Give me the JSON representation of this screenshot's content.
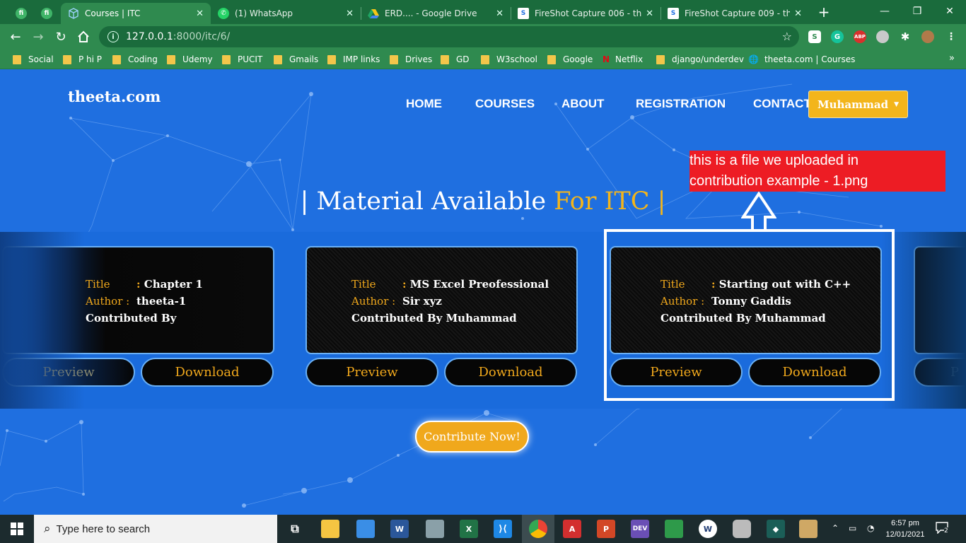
{
  "browser": {
    "tabs": [
      {
        "title": "Courses | ITC",
        "active": true
      },
      {
        "title": "(1) WhatsApp"
      },
      {
        "title": "ERD.... - Google Drive"
      },
      {
        "title": "FireShot Capture 006 - theeta"
      },
      {
        "title": "FireShot Capture 009 - theeta"
      }
    ],
    "pinned_tabs": [
      "fi",
      "fi"
    ],
    "url_host": "127.0.0.1",
    "url_path": ":8000/itc/6/",
    "bookmarks": [
      "Social",
      "P hi P",
      "Coding",
      "Udemy",
      "PUCIT",
      "Gmails",
      "IMP links",
      "Drives",
      "GD",
      "W3school",
      "Google",
      "Netflix",
      "django/underdev",
      "theeta.com | Courses"
    ],
    "bookmarks_more": "»",
    "accent": "#2f8a4f"
  },
  "site": {
    "brand": "theeta.com",
    "nav": [
      "HOME",
      "COURSES",
      "ABOUT",
      "REGISTRATION",
      "CONTACT"
    ],
    "user": "Muhammad",
    "heading_part1": "| Material Available ",
    "heading_part2": "For ITC |",
    "contribute_label": "Contribute Now!",
    "accent": "#f3b51b",
    "cards": [
      {
        "title_label": "Title",
        "title": "Chapter 1",
        "author_label": "Author :",
        "author": "theeta-1",
        "contributed": "Contributed By",
        "preview": "Preview",
        "download": "Download"
      },
      {
        "title_label": "Title",
        "title": "MS Excel Preofessional",
        "author_label": "Author :",
        "author": "Sir xyz",
        "contributed": "Contributed By Muhammad",
        "preview": "Preview",
        "download": "Download"
      },
      {
        "title_label": "Title",
        "title": "Starting out with C++",
        "author_label": "Author :",
        "author": "Tonny Gaddis",
        "contributed": "Contributed By Muhammad",
        "preview": "Preview",
        "download": "Download"
      }
    ],
    "peek_label": "P"
  },
  "annotation": {
    "line1": "this is a file we uploaded in",
    "line2": "contribution example - 1.png"
  },
  "taskbar": {
    "search_placeholder": "Type here to search",
    "time": "6:57 pm",
    "date": "12/01/2021",
    "notifications": "2"
  }
}
